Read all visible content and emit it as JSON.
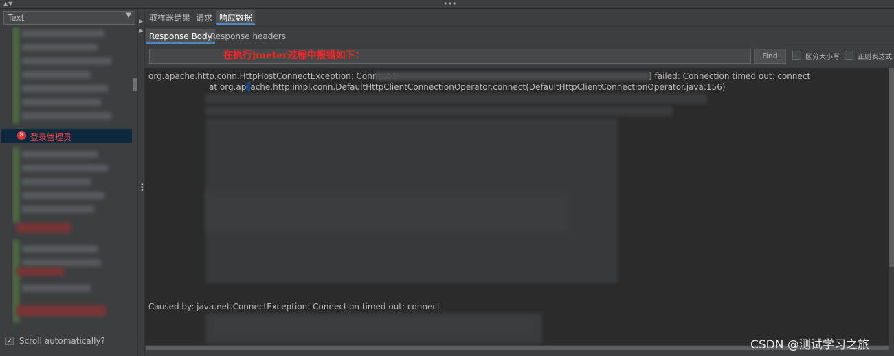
{
  "left_panel": {
    "renderer_select": "Text",
    "selected_sampler": "登录管理员",
    "scroll_automatically": "Scroll automatically?"
  },
  "tabs": [
    "取样器结果",
    "请求",
    "响应数据"
  ],
  "subtabs": [
    "Response Body",
    "Response headers"
  ],
  "search": {
    "placeholder": "",
    "find_label": "Find",
    "case_sensitive_label": "区分大小写",
    "regex_label": "正则表达式"
  },
  "annotation": "在执行jmeter过程中报错如下：",
  "response": {
    "line1_start": "org.apache.http.conn.HttpHostConnectException: Connect t",
    "line1_end": "] failed: Connection timed out: connect",
    "line2_a": "at org.ap",
    "line2_b": "ache.http.impl.conn.DefaultHttpClientConnectionOperator.connect(DefaultHttpClientConnectionOperator.java:156)",
    "caused_by": "Caused by: java.net.ConnectException: Connection timed out: connect"
  },
  "watermark": "CSDN @测试学习之旅",
  "colors": {
    "background": "#3c3f41",
    "text_area": "#2b2b2b",
    "accent": "#4a88c7",
    "error_red": "#ff2222"
  }
}
